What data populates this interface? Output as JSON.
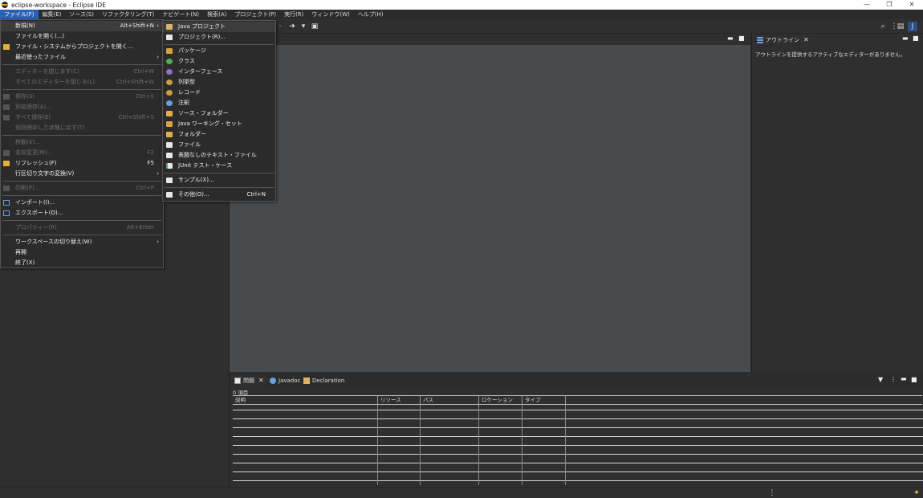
{
  "window": {
    "title": "eclipse-workspace - Eclipse IDE",
    "minimize": "—",
    "restore": "❐",
    "close": "✕"
  },
  "menubar": [
    "ファイル(F)",
    "編集(E)",
    "ソース(S)",
    "リファクタリング(T)",
    "ナビゲート(N)",
    "検索(A)",
    "プロジェクト(P)",
    "実行(R)",
    "ウィンドウ(W)",
    "ヘルプ(H)"
  ],
  "file_menu": {
    "new": {
      "label": "新規(N)",
      "shortcut": "Alt+Shift+N",
      "arrow": "›"
    },
    "open_file": {
      "label": "ファイルを開く(...)"
    },
    "open_from_fs": {
      "label": "ファイル・システムからプロジェクトを開く..."
    },
    "recent": {
      "label": "最近使ったファイル",
      "arrow": "›"
    },
    "close_editor": {
      "label": "エディターを閉じます(C)",
      "shortcut": "Ctrl+W"
    },
    "close_all": {
      "label": "すべてのエディターを閉じる(L)",
      "shortcut": "Ctrl+Shift+W"
    },
    "save": {
      "label": "保存(S)",
      "shortcut": "Ctrl+S"
    },
    "save_as": {
      "label": "別名保存(A)..."
    },
    "save_all": {
      "label": "すべて保存(E)",
      "shortcut": "Ctrl+Shift+S"
    },
    "revert": {
      "label": "前回保存した状態に戻す(T)"
    },
    "move": {
      "label": "移動(V)..."
    },
    "rename": {
      "label": "名前変更(M)...",
      "shortcut": "F2"
    },
    "refresh": {
      "label": "リフレッシュ(F)",
      "shortcut": "F5"
    },
    "line_delim": {
      "label": "行区切り文字の変換(V)",
      "arrow": "›"
    },
    "print": {
      "label": "印刷(P)...",
      "shortcut": "Ctrl+P"
    },
    "import": {
      "label": "インポート(I)..."
    },
    "export": {
      "label": "エクスポート(O)..."
    },
    "properties": {
      "label": "プロパティー(R)",
      "shortcut": "Alt+Enter"
    },
    "switch_ws": {
      "label": "ワークスペースの切り替え(W)",
      "arrow": "›"
    },
    "restart": {
      "label": "再開"
    },
    "exit": {
      "label": "終了(X)"
    }
  },
  "new_submenu": {
    "java_project": "Java プロジェクト",
    "project": "プロジェクト(R)...",
    "package": "パッケージ",
    "class": "クラス",
    "interface": "インターフェース",
    "enum": "列挙型",
    "record": "レコード",
    "annotation": "注釈",
    "source_folder": "ソース・フォルダー",
    "working_set": "Java ワーキング・セット",
    "folder": "フォルダー",
    "file": "ファイル",
    "untitled_text": "表題なしのテキスト・ファイル",
    "junit": "JUnit テスト・ケース",
    "sample": "サンプル(X)...",
    "other": "その他(O)...",
    "other_shortcut": "Ctrl+N"
  },
  "outline": {
    "tab": "アウトライン",
    "message": "アウトラインを提供するアクティブなエディターがありません。"
  },
  "problems": {
    "tabs": [
      "問題",
      "Javadoc",
      "Declaration"
    ],
    "count": "0 項目",
    "columns": [
      "説明",
      "リソース",
      "パス",
      "ロケーション",
      "タイプ"
    ]
  },
  "colors": {
    "accent": "#2a60b8",
    "editor_bg": "#484b4e",
    "panel_bg": "#2f2f2f"
  }
}
